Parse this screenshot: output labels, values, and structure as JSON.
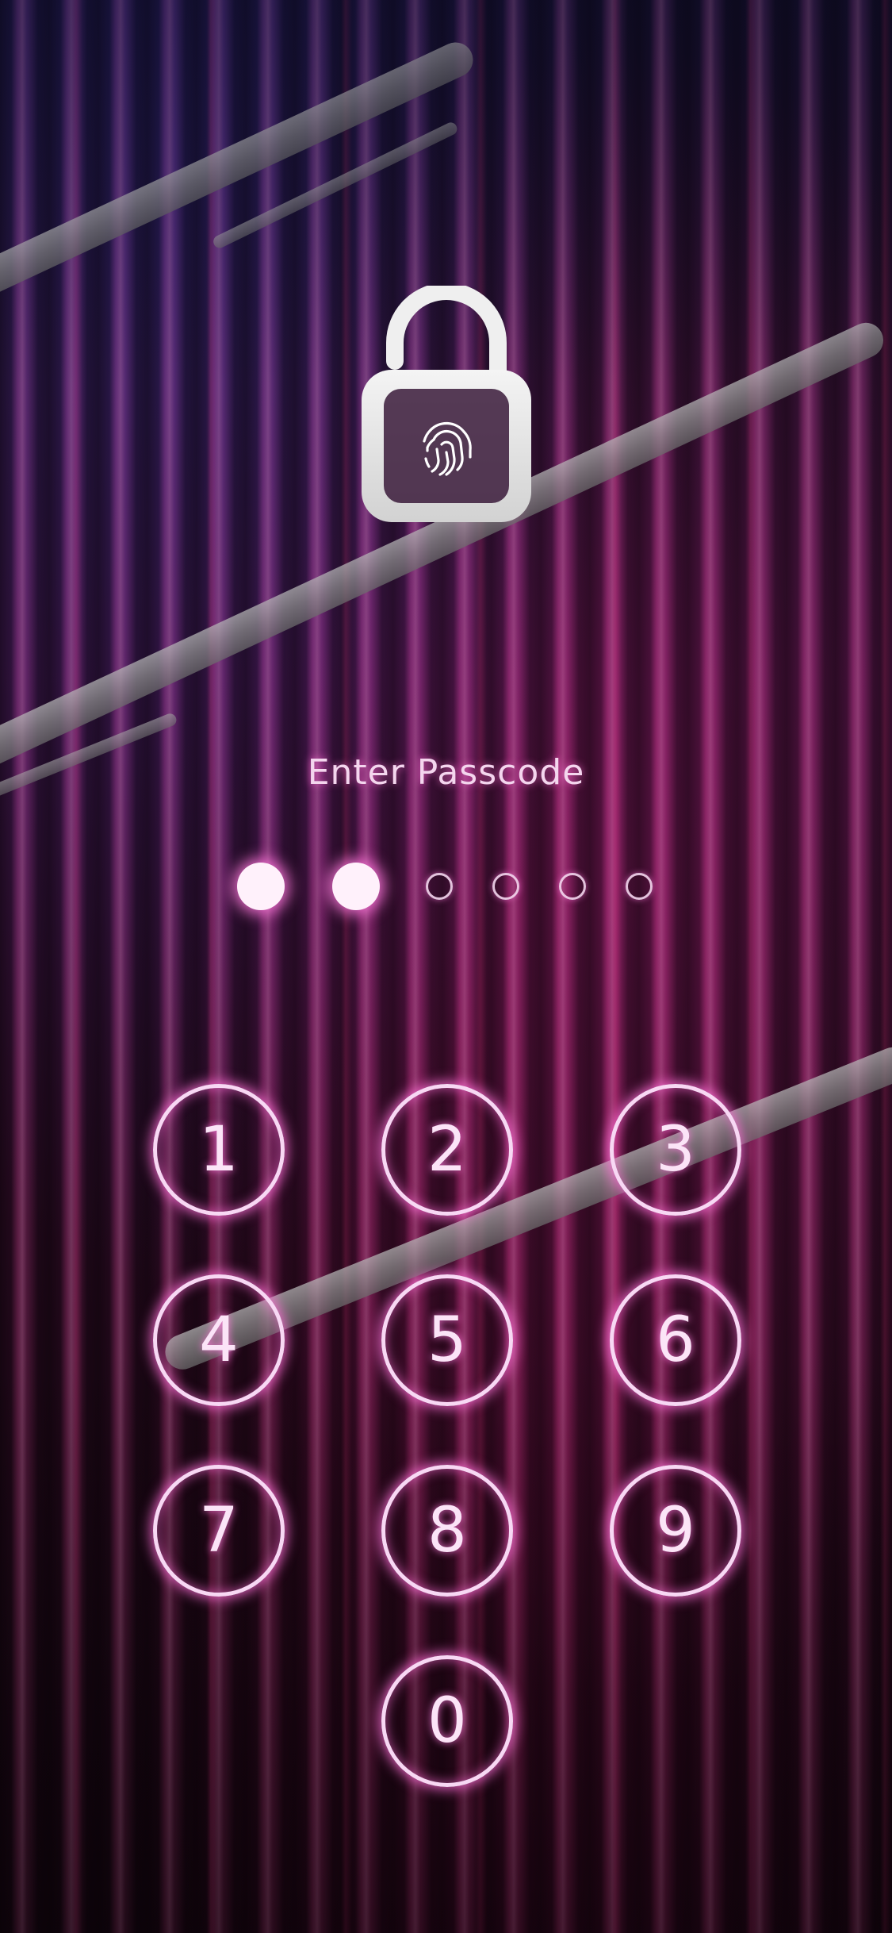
{
  "screen": {
    "title": "Enter Passcode"
  },
  "passcode": {
    "length": 6,
    "entered": 2
  },
  "keypad": {
    "keys": [
      "1",
      "2",
      "3",
      "4",
      "5",
      "6",
      "7",
      "8",
      "9",
      "0"
    ]
  },
  "icons": {
    "lock": "unlocked-padlock-fingerprint-icon"
  },
  "colors": {
    "glow": "#ff78dc",
    "ring": "#f8d8f4",
    "text": "#f4d6ee",
    "dot_filled": "#fff1fb"
  }
}
